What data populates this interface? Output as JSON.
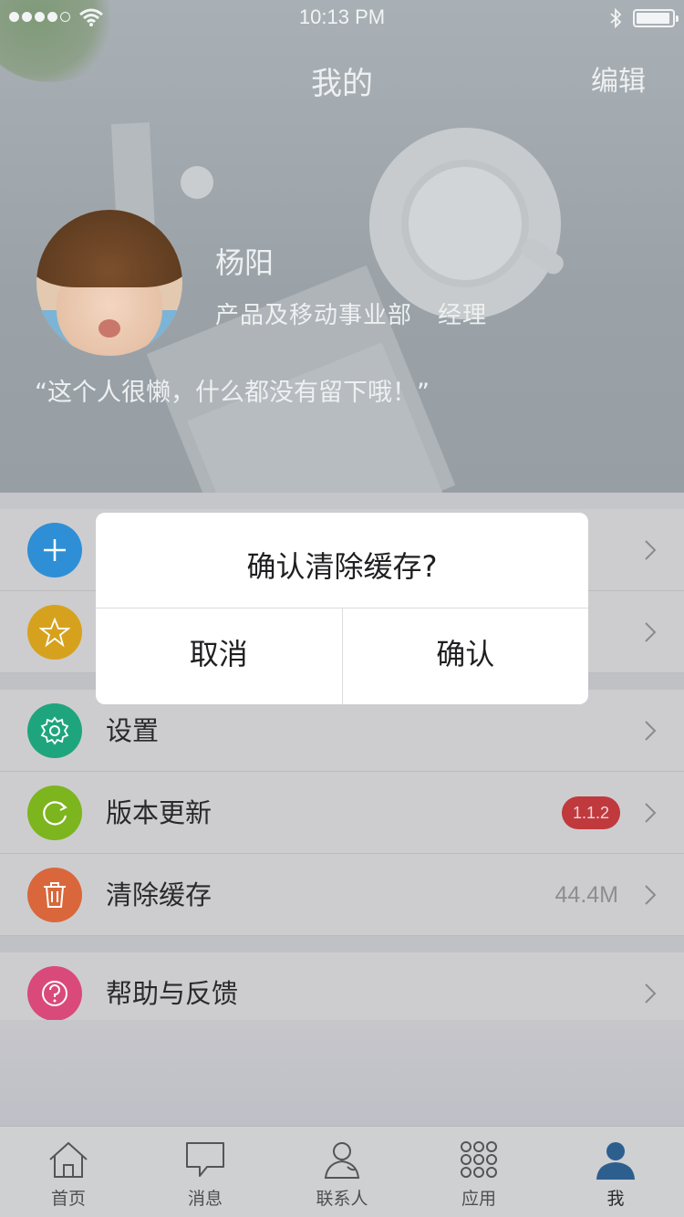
{
  "statusbar": {
    "signal_dots_on": 4,
    "signal_dots_total": 5,
    "time": "10:13 PM"
  },
  "nav": {
    "title": "我的",
    "edit_label": "编辑"
  },
  "profile": {
    "name": "杨阳",
    "department": "产品及移动事业部",
    "position": "经理",
    "motto": "“这个人很懒，什么都没有留下哦！”"
  },
  "menu": {
    "group1": [
      {
        "icon": "plus-icon",
        "color": "#2f8fd6"
      },
      {
        "icon": "star-icon",
        "color": "#d6a21e"
      }
    ],
    "group2": [
      {
        "icon": "gear-icon",
        "color": "#1fa57d",
        "label": "设置"
      },
      {
        "icon": "refresh-icon",
        "color": "#7cb51e",
        "label": "版本更新",
        "badge": "1.1.2"
      },
      {
        "icon": "trash-icon",
        "color": "#d9673b",
        "label": "清除缓存",
        "value": "44.4M"
      }
    ],
    "group3": [
      {
        "icon": "help-icon",
        "color": "#d94a7a",
        "label": "帮助与反馈"
      }
    ]
  },
  "dialog": {
    "title": "确认清除缓存?",
    "cancel_label": "取消",
    "confirm_label": "确认"
  },
  "tabbar": {
    "tabs": [
      {
        "label": "首页",
        "icon": "home-icon"
      },
      {
        "label": "消息",
        "icon": "message-icon"
      },
      {
        "label": "联系人",
        "icon": "contacts-icon"
      },
      {
        "label": "应用",
        "icon": "apps-icon"
      },
      {
        "label": "我",
        "icon": "me-icon",
        "active": true
      }
    ],
    "active_color": "#2c5f8e"
  }
}
